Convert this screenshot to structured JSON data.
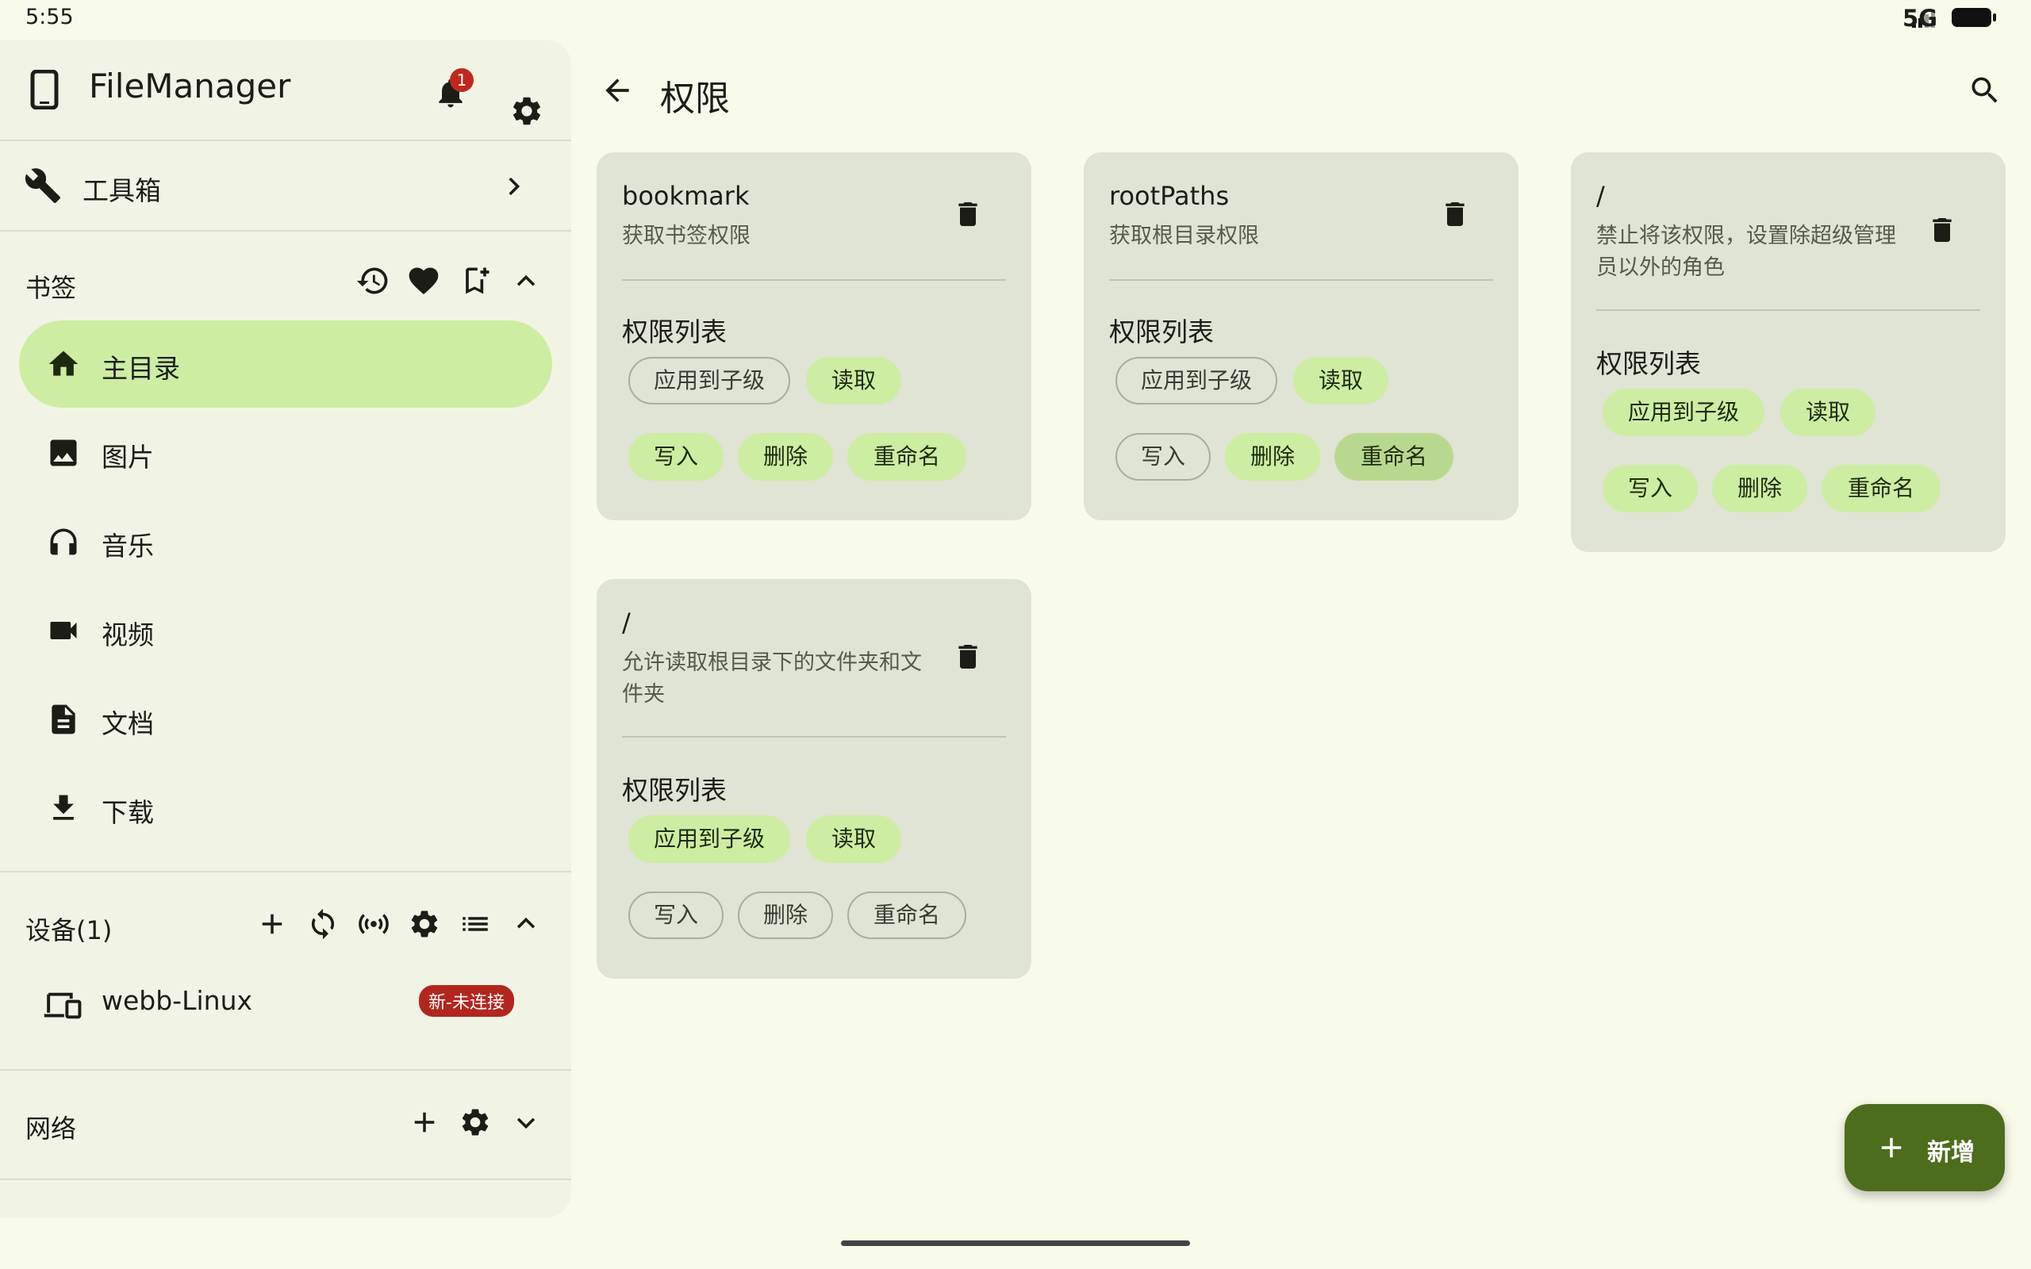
{
  "status_bar": {
    "time": "5:55",
    "network": "5G"
  },
  "drawer": {
    "app_title": "FileManager",
    "notification_count": "1",
    "toolbox_label": "工具箱",
    "bookmarks": {
      "label": "书签",
      "items": [
        {
          "label": "主目录",
          "icon": "home-icon",
          "active": true
        },
        {
          "label": "图片",
          "icon": "image-icon"
        },
        {
          "label": "音乐",
          "icon": "headphones-icon"
        },
        {
          "label": "视频",
          "icon": "video-icon"
        },
        {
          "label": "文档",
          "icon": "document-icon"
        },
        {
          "label": "下载",
          "icon": "download-icon"
        }
      ]
    },
    "devices": {
      "label": "设备(1)",
      "items": [
        {
          "label": "webb-Linux",
          "badge": "新-未连接"
        }
      ]
    },
    "network": {
      "label": "网络"
    }
  },
  "main": {
    "title": "权限",
    "cards": [
      {
        "title": "bookmark",
        "description": "获取书签权限",
        "list_label": "权限列表",
        "chips": [
          {
            "label": "应用到子级",
            "state": "off"
          },
          {
            "label": "读取",
            "state": "on"
          },
          {
            "label": "写入",
            "state": "on"
          },
          {
            "label": "删除",
            "state": "on"
          },
          {
            "label": "重命名",
            "state": "on"
          }
        ]
      },
      {
        "title": "rootPaths",
        "description": "获取根目录权限",
        "list_label": "权限列表",
        "chips": [
          {
            "label": "应用到子级",
            "state": "off"
          },
          {
            "label": "读取",
            "state": "on"
          },
          {
            "label": "写入",
            "state": "off"
          },
          {
            "label": "删除",
            "state": "on"
          },
          {
            "label": "重命名",
            "state": "highlight"
          }
        ]
      },
      {
        "title": "/",
        "description": "禁止将该权限，设置除超级管理员以外的角色",
        "list_label": "权限列表",
        "chips": [
          {
            "label": "应用到子级",
            "state": "on"
          },
          {
            "label": "读取",
            "state": "on"
          },
          {
            "label": "写入",
            "state": "on"
          },
          {
            "label": "删除",
            "state": "on"
          },
          {
            "label": "重命名",
            "state": "on"
          }
        ]
      },
      {
        "title": "/",
        "description": "允许读取根目录下的文件夹和文件夹",
        "list_label": "权限列表",
        "chips": [
          {
            "label": "应用到子级",
            "state": "on"
          },
          {
            "label": "读取",
            "state": "on"
          },
          {
            "label": "写入",
            "state": "off"
          },
          {
            "label": "删除",
            "state": "off"
          },
          {
            "label": "重命名",
            "state": "off"
          }
        ]
      }
    ],
    "fab_label": "新增"
  },
  "colors": {
    "background": "#f8fbea",
    "chip_selected": "#cdeda3",
    "fab": "#4c6d1b",
    "badge": "#b3261e"
  }
}
